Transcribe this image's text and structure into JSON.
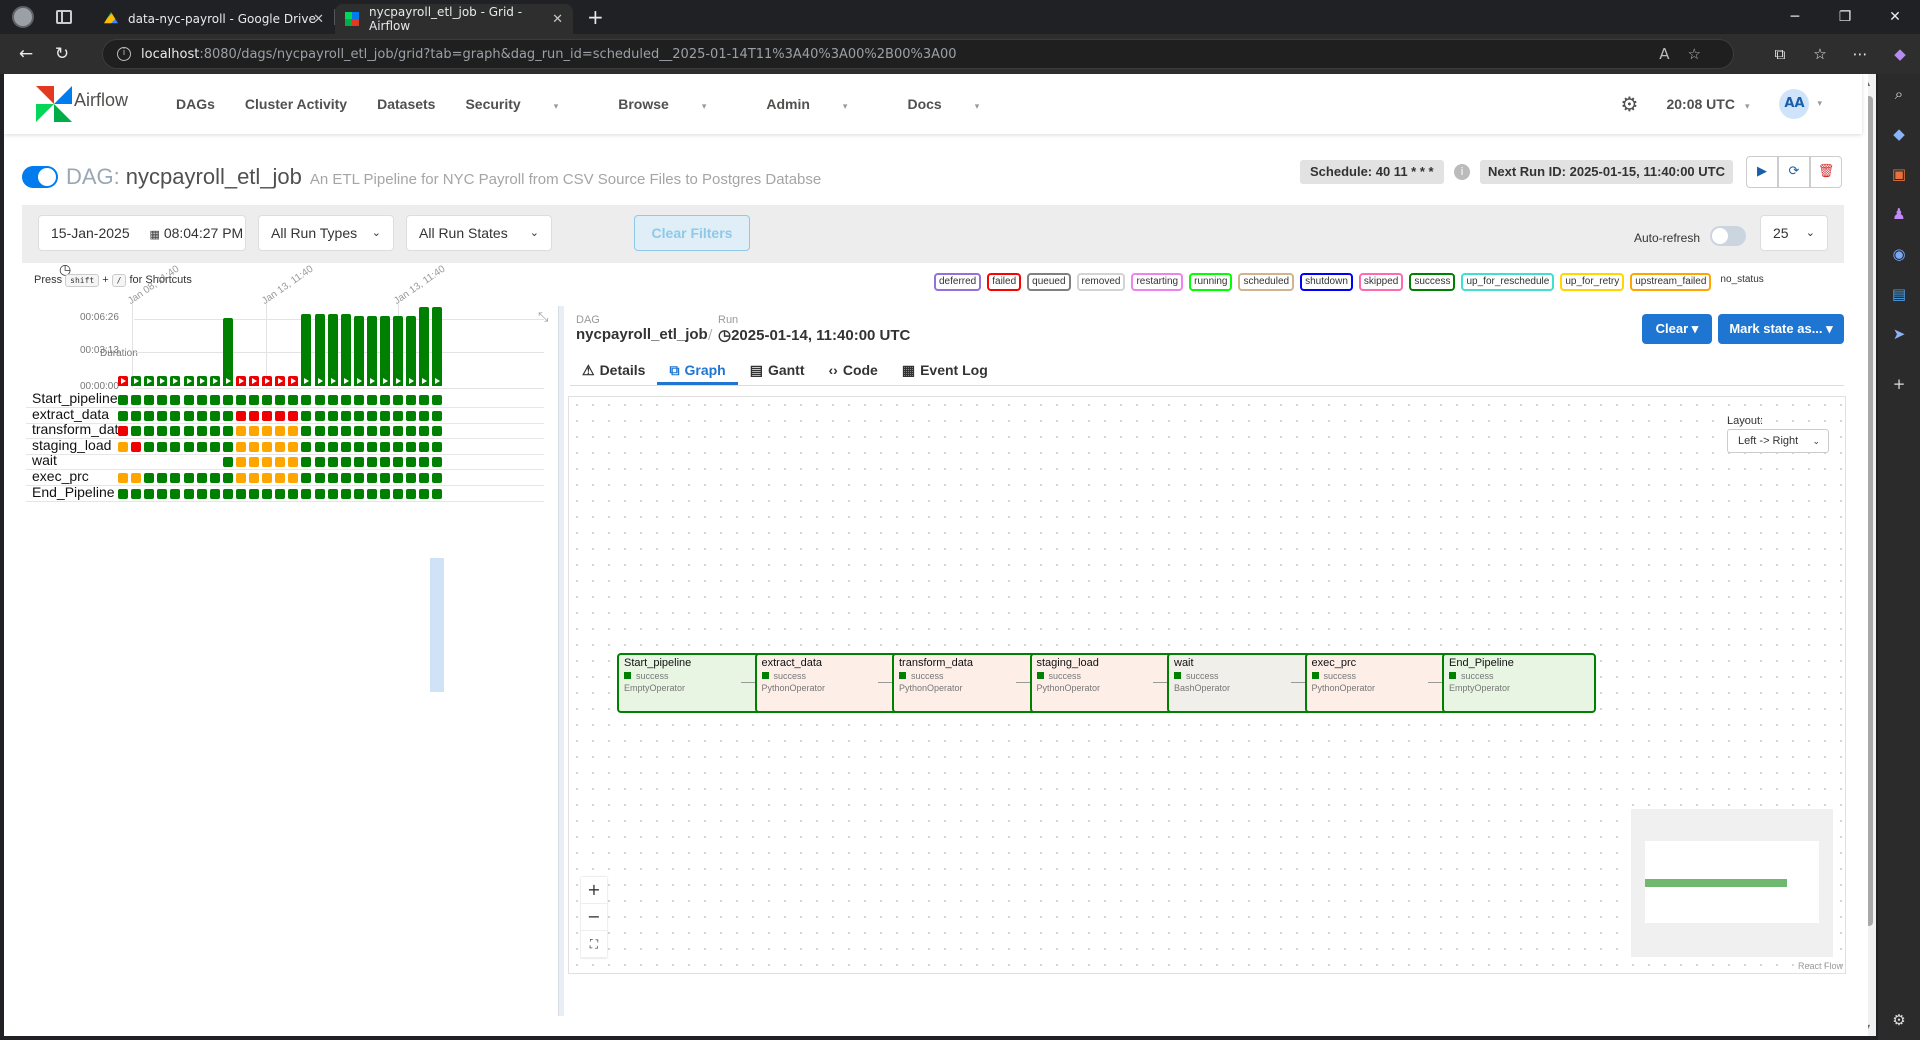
{
  "browser": {
    "tabs": [
      {
        "title": "data-nyc-payroll - Google Drive"
      },
      {
        "title": "nycpayroll_etl_job - Grid - Airflow"
      }
    ],
    "url_host": "localhost",
    "url_rest": ":8080/dags/nycpayroll_etl_job/grid?tab=graph&dag_run_id=scheduled__2025-01-14T11%3A40%3A00%2B00%3A00"
  },
  "nav": {
    "brand": "Airflow",
    "menu": [
      "DAGs",
      "Cluster Activity",
      "Datasets",
      "Security",
      "Browse",
      "Admin",
      "Docs"
    ],
    "time": "20:08 UTC",
    "user_initials": "AA"
  },
  "dag": {
    "word": "DAG:",
    "name": "nycpayroll_etl_job",
    "description": "An ETL Pipeline for NYC Payroll from CSV Source Files to Postgres Databse",
    "schedule": "Schedule: 40 11 * * *",
    "next_run": "Next Run ID: 2025-01-15, 11:40:00 UTC"
  },
  "filters": {
    "date": "15-Jan-2025",
    "time": "08:04:27 PM",
    "run_types": "All Run Types",
    "run_states": "All Run States",
    "clear": "Clear Filters",
    "auto_refresh": "Auto-refresh",
    "page_size": "25"
  },
  "shortcuts": {
    "press": "Press",
    "key1": "shift",
    "key2": "/",
    "suffix": "for Shortcuts"
  },
  "legend": [
    {
      "label": "deferred",
      "color": "#9370db"
    },
    {
      "label": "failed",
      "color": "#ff0000"
    },
    {
      "label": "queued",
      "color": "#808080"
    },
    {
      "label": "removed",
      "color": "#d3d3d3"
    },
    {
      "label": "restarting",
      "color": "#ee82ee"
    },
    {
      "label": "running",
      "color": "#00ff00"
    },
    {
      "label": "scheduled",
      "color": "#d2b48c"
    },
    {
      "label": "shutdown",
      "color": "#0000ff"
    },
    {
      "label": "skipped",
      "color": "#ff69b4"
    },
    {
      "label": "success",
      "color": "#008000"
    },
    {
      "label": "up_for_reschedule",
      "color": "#40e0d0"
    },
    {
      "label": "up_for_retry",
      "color": "#ffd700"
    },
    {
      "label": "upstream_failed",
      "color": "#ffa500"
    },
    {
      "label": "no_status",
      "color": "#ffffff"
    }
  ],
  "grid": {
    "duration_label": "Duration",
    "y_ticks": [
      "00:06:26",
      "00:03:13",
      "00:00:00"
    ],
    "date_ticks": [
      "Jan 08, 11:40",
      "Jan 13, 11:40",
      "Jan 13, 11:40"
    ],
    "run_states": [
      "failed",
      "success",
      "success",
      "success",
      "success",
      "success",
      "success",
      "success",
      "success",
      "failed",
      "failed",
      "failed",
      "failed",
      "failed",
      "success",
      "success",
      "success",
      "success",
      "success",
      "success",
      "success",
      "success",
      "success",
      "success",
      "success"
    ],
    "run_durations_min": [
      0.1,
      0.1,
      0.1,
      0.1,
      0.1,
      0.1,
      0.1,
      0.1,
      5.6,
      0.1,
      0.1,
      0.1,
      0.1,
      0.1,
      5.9,
      5.9,
      5.9,
      5.9,
      5.8,
      5.8,
      5.8,
      5.8,
      5.8,
      6.5,
      6.5
    ],
    "tasks": [
      {
        "name": "Start_pipeline",
        "states": "SSSSSSSSSSSSSSSSSSSSSSSSS"
      },
      {
        "name": "extract_data",
        "states": "SSSSSSSSSFFFFFSSSSSSSSSSS"
      },
      {
        "name": "transform_data",
        "states": "FSSSSSSSSUUUUUSSSSSSSSSSS"
      },
      {
        "name": "staging_load",
        "states": "UFSSSSSSSUUUUUSSSSSSSSSSS"
      },
      {
        "name": "wait",
        "states": "--------SUUUUUSSSSSSSSSSS"
      },
      {
        "name": "exec_prc",
        "states": "UUSSSSSSSUUUUUSSSSSSSSSSS"
      },
      {
        "name": "End_Pipeline",
        "states": "SSSSSSSSSSSSSSSSSSSSSSSSS"
      }
    ]
  },
  "details": {
    "dag_label": "DAG",
    "dag_name": "nycpayroll_etl_job",
    "run_label": "Run",
    "run_id": "2025-01-14, 11:40:00 UTC",
    "clear_btn": "Clear",
    "mark_btn": "Mark state as...",
    "tabs": [
      {
        "label": "Details",
        "icon": "warning-icon"
      },
      {
        "label": "Graph",
        "icon": "graph-icon"
      },
      {
        "label": "Gantt",
        "icon": "gantt-icon"
      },
      {
        "label": "Code",
        "icon": "code-icon"
      },
      {
        "label": "Event Log",
        "icon": "log-icon"
      }
    ],
    "layout_label": "Layout:",
    "layout_value": "Left -> Right",
    "react_flow": "React Flow",
    "nodes": [
      {
        "name": "Start_pipeline",
        "state": "success",
        "operator": "EmptyOperator",
        "bg": "#e8f5e3"
      },
      {
        "name": "extract_data",
        "state": "success",
        "operator": "PythonOperator",
        "bg": "#fdeee8"
      },
      {
        "name": "transform_data",
        "state": "success",
        "operator": "PythonOperator",
        "bg": "#fdeee8"
      },
      {
        "name": "staging_load",
        "state": "success",
        "operator": "PythonOperator",
        "bg": "#fdeee8"
      },
      {
        "name": "wait",
        "state": "success",
        "operator": "BashOperator",
        "bg": "#f1efea"
      },
      {
        "name": "exec_prc",
        "state": "success",
        "operator": "PythonOperator",
        "bg": "#fdeee8"
      },
      {
        "name": "End_Pipeline",
        "state": "success",
        "operator": "EmptyOperator",
        "bg": "#e8f5e3"
      }
    ]
  }
}
